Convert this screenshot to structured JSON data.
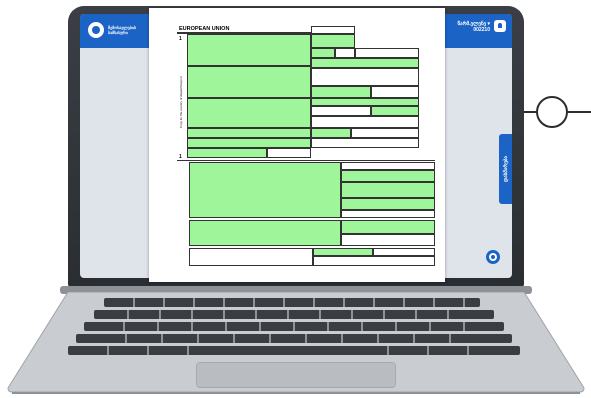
{
  "app": {
    "logo_line1": "შემოსავლების",
    "logo_line2": "სამსახური",
    "user_name": "წარმ.ელენე ▾",
    "user_id": "002210",
    "side_tab_label": "დახმარება"
  },
  "document": {
    "title": "EUROPEAN UNION",
    "copy_number": "1",
    "box_number_bottom": "1",
    "vertical_caption": "Copy for the country of dispatch/export"
  },
  "colors": {
    "app_blue": "#1b64c6",
    "form_green": "#9ff59a",
    "laptop_dark": "#2a2d31"
  },
  "icons": [
    "app-logo-icon",
    "bell-icon",
    "chat-icon",
    "callout-circle-icon"
  ]
}
